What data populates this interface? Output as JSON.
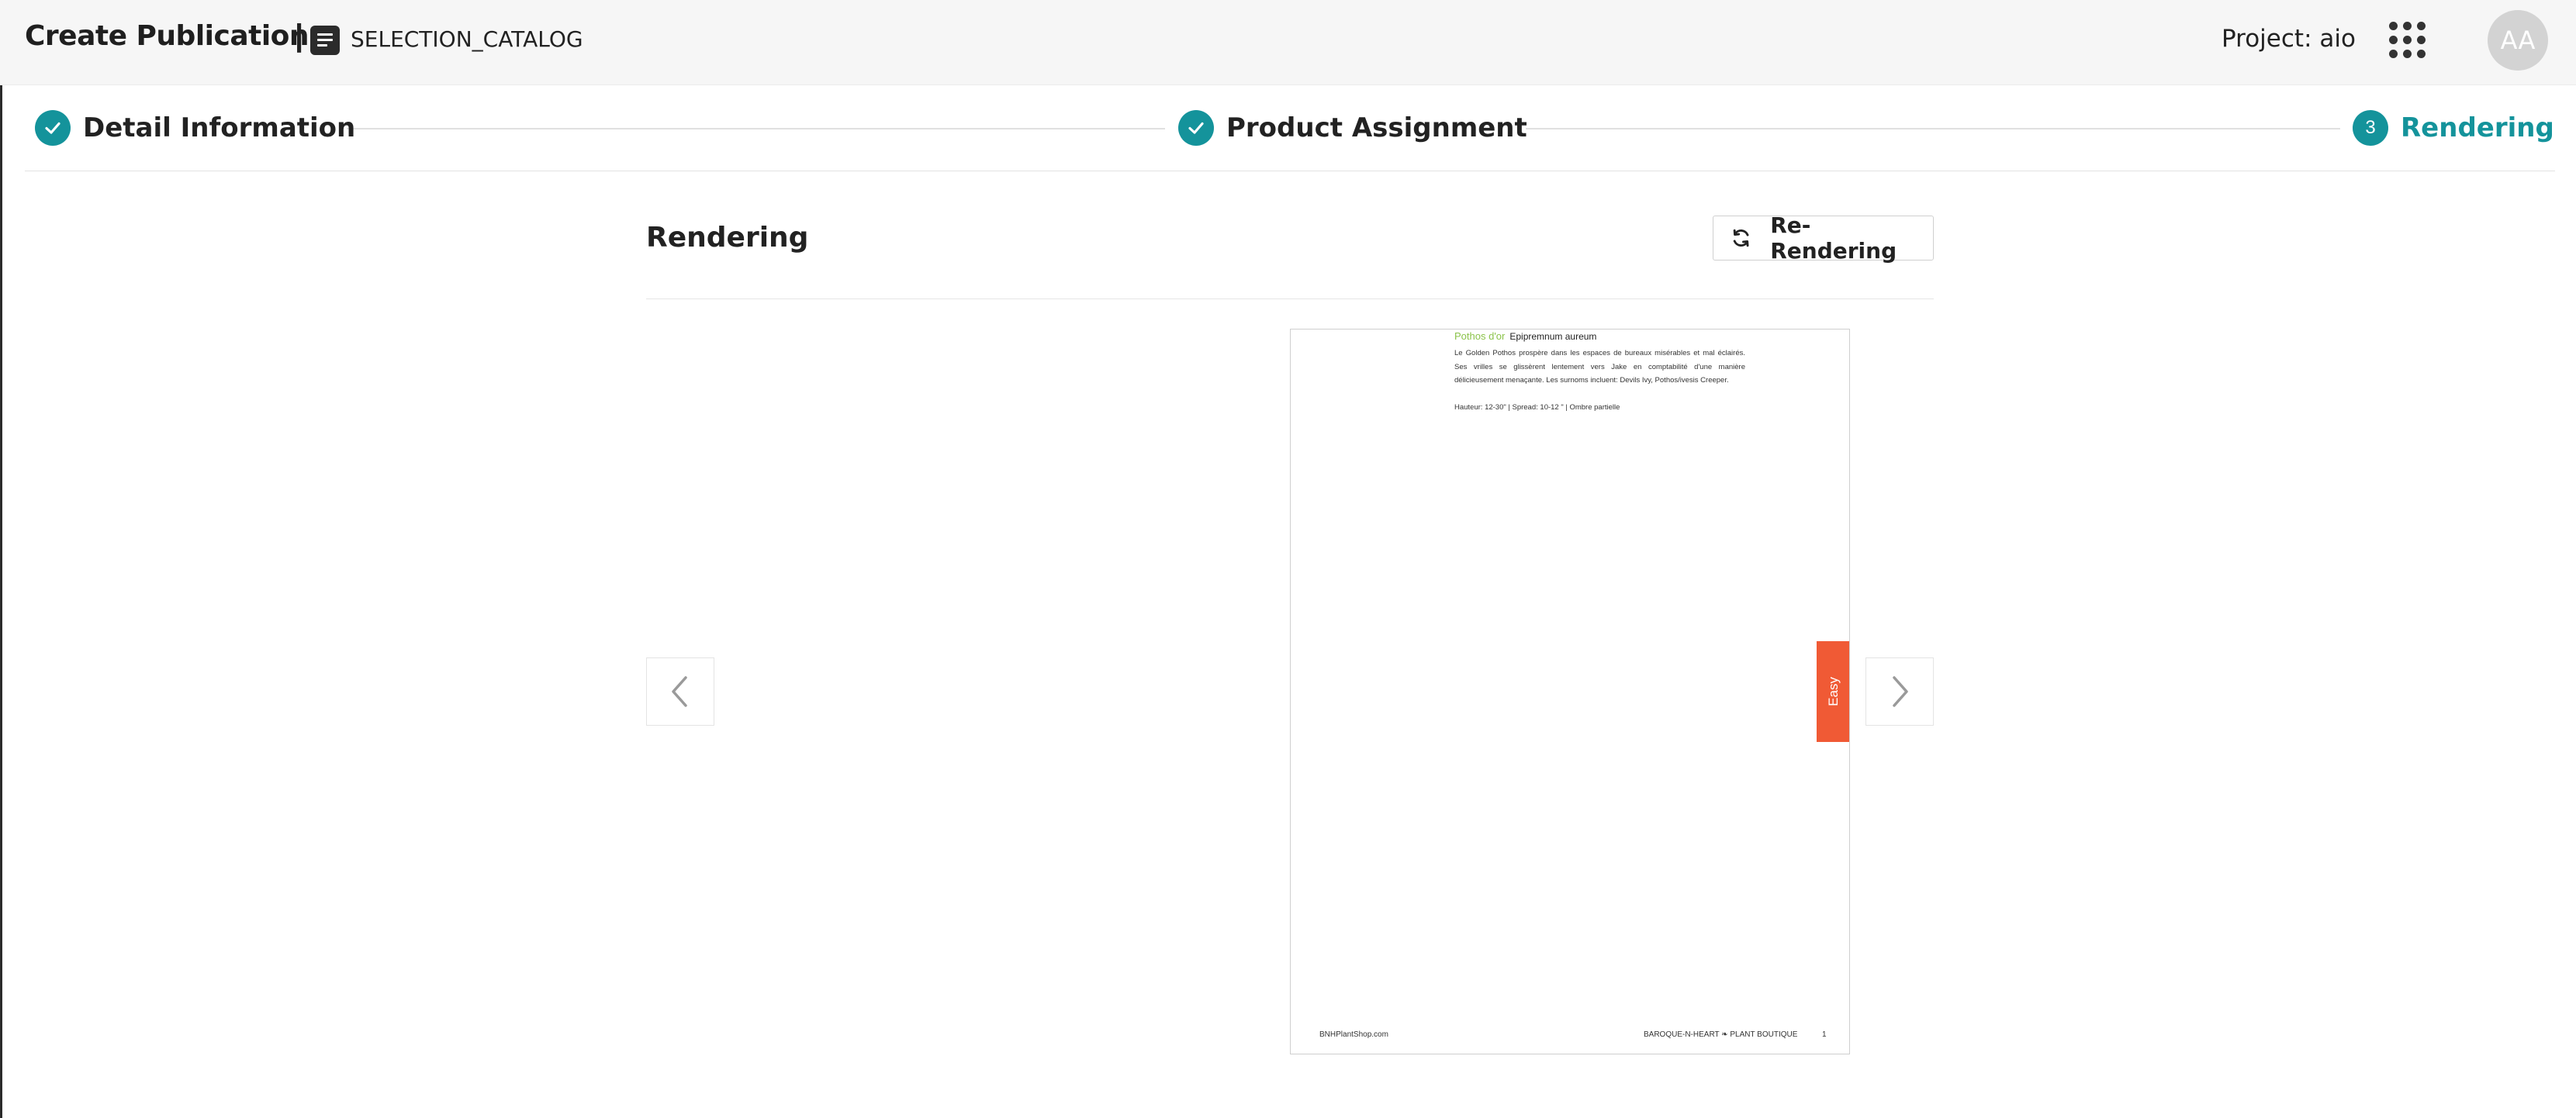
{
  "header": {
    "title": "Create Publication",
    "separator": "|",
    "catalog_name": "SELECTION_CATALOG",
    "catalog_icon": "document-icon",
    "project_label": "Project: aio",
    "apps_icon": "apps-grid-icon",
    "avatar_initials": "AA"
  },
  "stepper": {
    "steps": [
      {
        "label": "Detail Information",
        "status": "completed",
        "icon": "check-icon"
      },
      {
        "label": "Product Assignment",
        "status": "completed",
        "icon": "check-icon"
      },
      {
        "label": "Rendering",
        "status": "active",
        "number": "3"
      }
    ],
    "accent_color": "#14939b"
  },
  "rendering": {
    "title": "Rendering",
    "rerender_label": "Re-Rendering",
    "rerender_icon": "refresh-icon",
    "prev_icon": "chevron-left-icon",
    "next_icon": "chevron-right-icon"
  },
  "preview": {
    "product_name": "Pothos d'or",
    "product_latin": "Epipremnum aureum",
    "description": "Le Golden Pothos prospère dans les espaces de bureaux misérables et mal éclairés. Ses vrilles se glissèrent lentement vers Jake en comptabilité d'une manière délicieusement menaçante. Les surnoms incluent: Devils Ivy, Pothos/ivesis Creeper.",
    "specs": "Hauteur: 12-30\" | Spread: 10-12 \" | Ombre partielle",
    "difficulty_tab": "Easy",
    "difficulty_color": "#f05a35",
    "footer_left": "BNHPlantShop.com",
    "footer_right": "BAROQUE-N-HEART ❧ PLANT BOUTIQUE",
    "page_number": "1"
  }
}
